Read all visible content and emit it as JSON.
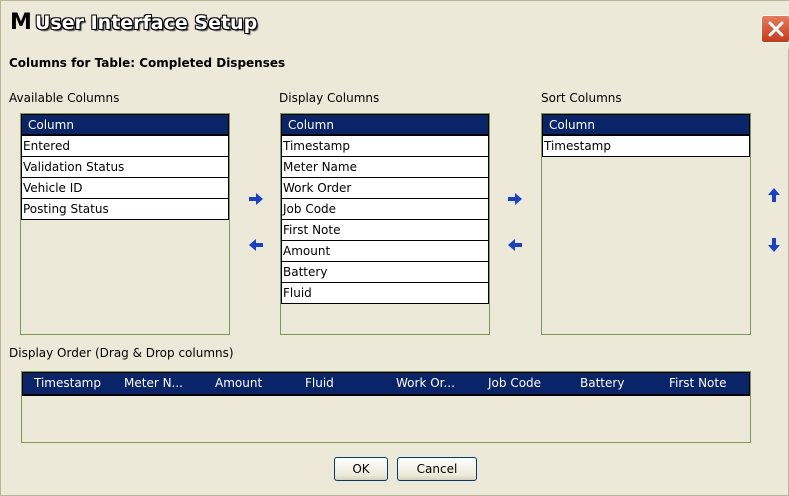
{
  "window": {
    "logo": "M",
    "title": "User Interface Setup"
  },
  "subtitle": "Columns for Table: Completed Dispenses",
  "available": {
    "label": "Available Columns",
    "header": "Column",
    "items": [
      "Entered",
      "Validation Status",
      "Vehicle ID",
      "Posting Status"
    ]
  },
  "display": {
    "label": "Display Columns",
    "header": "Column",
    "items": [
      "Timestamp",
      "Meter Name",
      "Work Order",
      "Job Code",
      "First Note",
      "Amount",
      "Battery",
      "Fluid"
    ]
  },
  "sort": {
    "label": "Sort Columns",
    "header": "Column",
    "items": [
      "Timestamp"
    ]
  },
  "display_order": {
    "label": "Display Order (Drag & Drop columns)",
    "columns": [
      "Timestamp",
      "Meter N...",
      "Amount",
      "Fluid",
      "Work Or...",
      "Job Code",
      "Battery",
      "First Note"
    ]
  },
  "buttons": {
    "ok": "OK",
    "cancel": "Cancel"
  },
  "icons": {
    "close": "close-icon",
    "move_right": "arrow-right-icon",
    "move_left": "arrow-left-icon",
    "move_up": "arrow-up-icon",
    "move_down": "arrow-down-icon"
  },
  "colors": {
    "header_bg": "#0a246a",
    "arrow": "#1840c8",
    "close": "#d24a27"
  }
}
